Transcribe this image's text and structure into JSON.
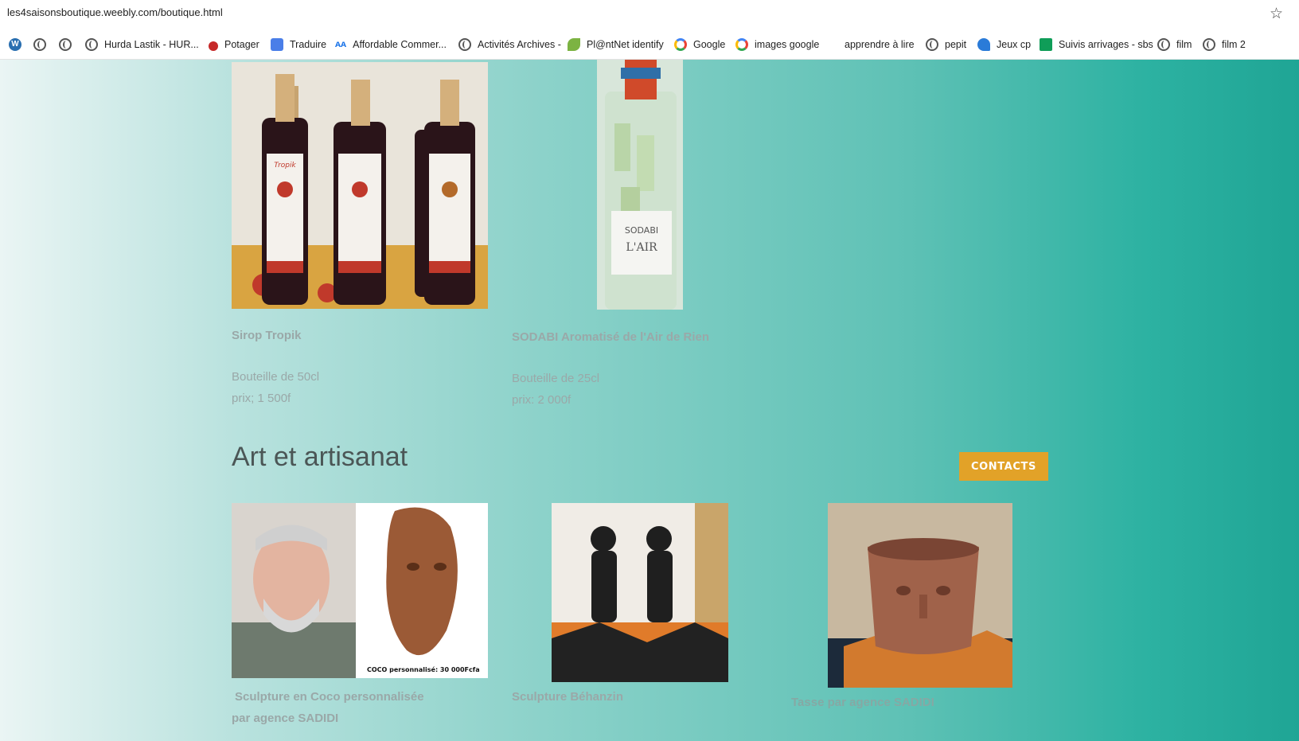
{
  "browser": {
    "url": "les4saisonsboutique.weebly.com/boutique.html",
    "bookmarks": [
      {
        "label": "",
        "icon": "wordpress-icon"
      },
      {
        "label": "",
        "icon": "globe-icon"
      },
      {
        "label": "",
        "icon": "globe-icon"
      },
      {
        "label": "Hurda Lastik - HUR...",
        "icon": "globe-icon"
      },
      {
        "label": "Potager",
        "icon": "cherry-icon"
      },
      {
        "label": "Traduire",
        "icon": "google-translate-icon"
      },
      {
        "label": "Affordable Commer...",
        "icon": "aa-icon"
      },
      {
        "label": "Activités Archives -",
        "icon": "globe-icon"
      },
      {
        "label": "Pl@ntNet identify",
        "icon": "plant-icon"
      },
      {
        "label": "Google",
        "icon": "google-icon"
      },
      {
        "label": "images google",
        "icon": "google-icon"
      },
      {
        "label": "apprendre à lire",
        "icon": ""
      },
      {
        "label": "pepit",
        "icon": "globe-icon"
      },
      {
        "label": "Jeux cp",
        "icon": "dolphin-icon"
      },
      {
        "label": "Suivis arrivages - sbs",
        "icon": "sheets-icon"
      },
      {
        "label": "film",
        "icon": "globe-icon"
      },
      {
        "label": "film 2",
        "icon": "globe-icon"
      }
    ]
  },
  "products_top": [
    {
      "title": "Sirop Tropik",
      "size": "Bouteille de 50cl",
      "price": "prix; 1 500f",
      "image_label": "Tropik"
    },
    {
      "title": "SODABI Aromatisé de l'Air de Rien",
      "size": "Bouteille de 25cl",
      "price": "prix: 2 000f",
      "image_label": "SODABI DE L'AIR"
    }
  ],
  "section": {
    "heading": "Art et artisanat",
    "contacts_label": "CONTACTS"
  },
  "products_bottom": [
    {
      "title": "Sculpture en Coco personnalisée",
      "title2": "par agence SADIDI",
      "image_caption": "COCO personnalisé: 30 000Fcfa"
    },
    {
      "title": "Sculpture Béhanzin"
    },
    {
      "title": "Tasse par agence SADIDI"
    }
  ],
  "colors": {
    "accent_button": "#e2a228",
    "muted_text": "#9aa8a8",
    "heading_text": "#4b5656"
  }
}
